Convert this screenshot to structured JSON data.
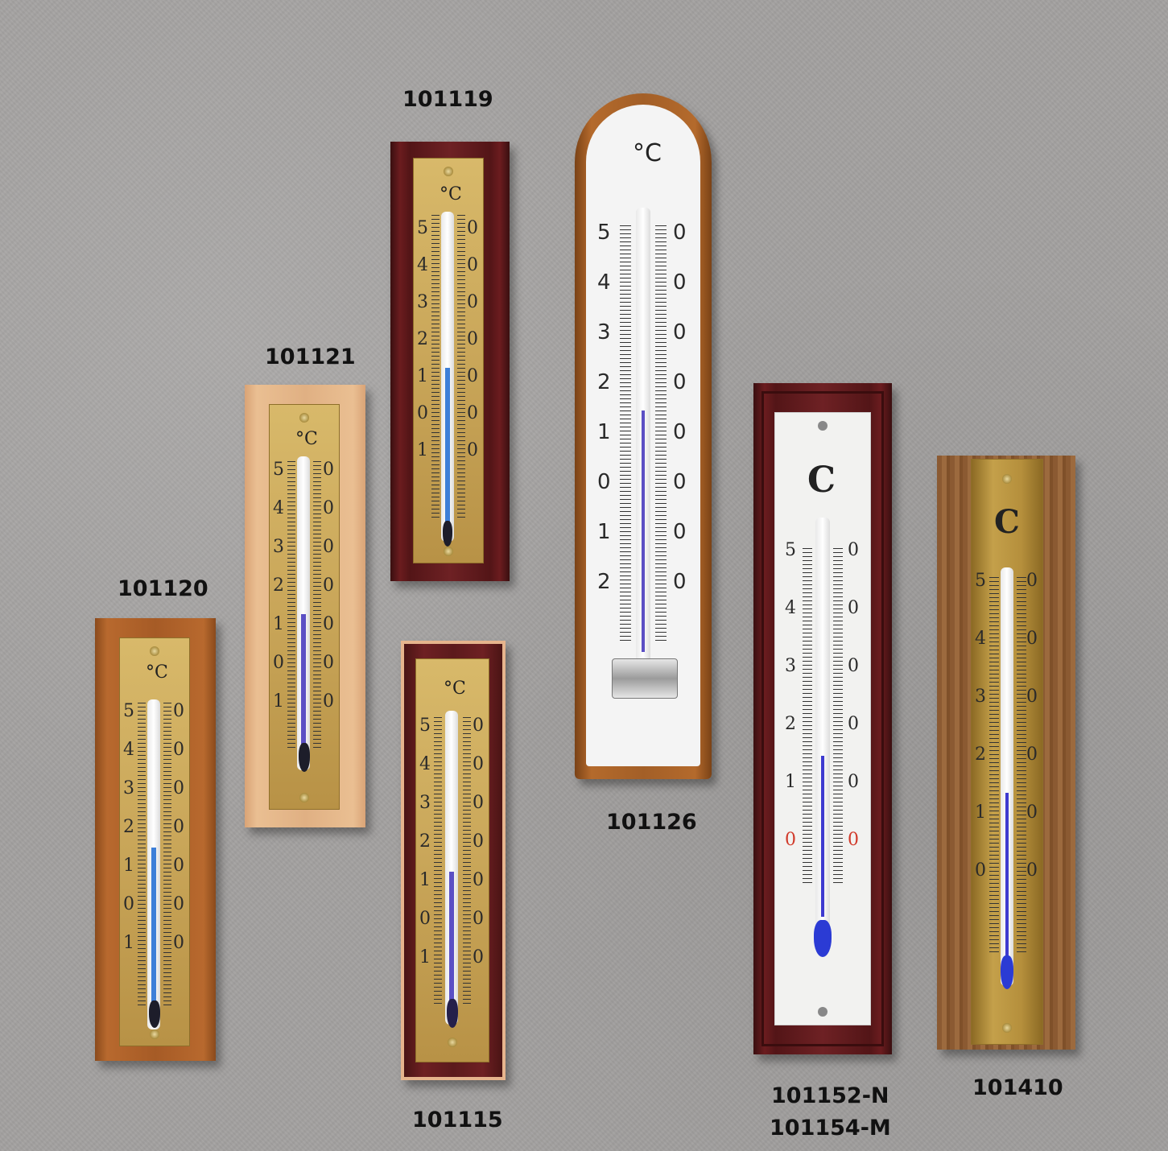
{
  "labels": {
    "t101119": "101119",
    "t101121": "101121",
    "t101120": "101120",
    "t101115": "101115",
    "t101126": "101126",
    "t101152": "101152-N",
    "t101154": "101154-M",
    "t101410": "101410"
  },
  "scale": {
    "unit": "°C",
    "unit_old": "C",
    "left_digits": [
      "5",
      "4",
      "3",
      "2",
      "1",
      "0",
      "1"
    ],
    "right_digits": [
      "0",
      "0",
      "0",
      "0",
      "0",
      "0",
      "0"
    ],
    "left_digits_126": [
      "5",
      "4",
      "3",
      "2",
      "1",
      "0",
      "1",
      "2"
    ],
    "right_digits_126": [
      "0",
      "0",
      "0",
      "0",
      "0",
      "0",
      "0",
      "0"
    ],
    "left_digits_152": [
      "5",
      "4",
      "3",
      "2",
      "1",
      "0"
    ],
    "right_digits_152": [
      "0",
      "0",
      "0",
      "0",
      "0",
      "0"
    ],
    "left_digits_410": [
      "5",
      "4",
      "3",
      "2",
      "1",
      "0"
    ],
    "right_digits_410": [
      "0",
      "0",
      "0",
      "0",
      "0",
      "0"
    ]
  },
  "colors": {
    "background": "#a3a1a0",
    "liquid_blue": "#3d7fd8",
    "liquid_violet": "#5b4fc4",
    "bulb_dark": "#1d1d2a",
    "zero_red": "#d13a2a"
  }
}
